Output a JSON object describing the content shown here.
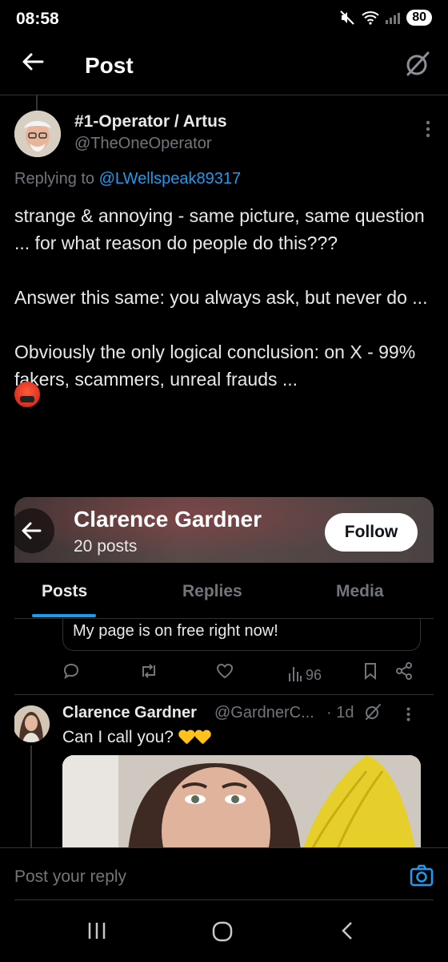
{
  "status": {
    "time": "08:58",
    "battery": "80"
  },
  "header": {
    "title": "Post"
  },
  "post": {
    "author_name": "#1-Operator / Artus",
    "author_handle": "@TheOneOperator",
    "replying_prefix": "Replying to",
    "replying_handle": "@LWellspeak89317",
    "paragraphs": [
      "strange & annoying - same picture, same question ... for what reason do people do this???",
      "Answer this same: you always ask, but never do ...",
      "Obviously the only logical conclusion: on X - 99% fakers, scammers, unreal frauds ..."
    ],
    "emoji_icon": "angry-cursing-face-emoji"
  },
  "embedded": {
    "profile_name": "Clarence Gardner",
    "posts_count": "20 posts",
    "follow_label": "Follow",
    "tabs": [
      "Posts",
      "Replies",
      "Media"
    ],
    "active_tab": "Posts",
    "snippet_text": "My page is on free right now!",
    "views": "96",
    "reply": {
      "name": "Clarence Gardner",
      "handle": "@GardnerC...",
      "time": "· 1d",
      "text": "Can I call you?"
    }
  },
  "compose": {
    "placeholder": "Post your reply"
  },
  "colors": {
    "accent": "#1d9bf0",
    "background": "#000000",
    "text": "#e7e9ea",
    "muted": "#71767b"
  }
}
